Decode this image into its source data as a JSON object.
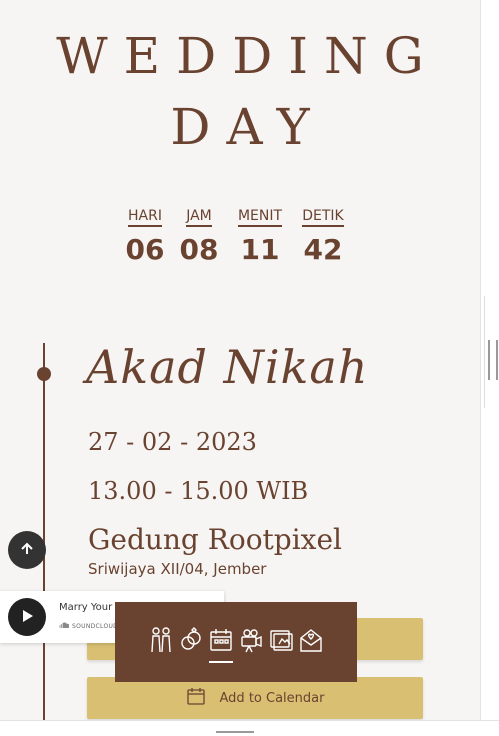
{
  "hero": {
    "title_line1": "WEDDING",
    "title_line2": "DAY"
  },
  "countdown": {
    "items": [
      {
        "label": "HARI",
        "value": "06"
      },
      {
        "label": "JAM",
        "value": "08"
      },
      {
        "label": "MENIT",
        "value": "11"
      },
      {
        "label": "DETIK",
        "value": "42"
      }
    ]
  },
  "event": {
    "title": "Akad Nikah",
    "date": "27 - 02 - 2023",
    "time": "13.00 - 15.00 WIB",
    "venue": "Gedung Rootpixel",
    "address": "Sriwijaya XII/04, Jember",
    "calendar_button_label": "Add to Calendar"
  },
  "music_player": {
    "song_title": "Marry Your D",
    "brand": "SOUNDCLOUD"
  },
  "bottom_nav": {
    "items": [
      {
        "icon": "couple-icon"
      },
      {
        "icon": "rings-icon"
      },
      {
        "icon": "calendar-icon",
        "active": true
      },
      {
        "icon": "camera-icon"
      },
      {
        "icon": "photo-gallery-icon"
      },
      {
        "icon": "envelope-icon"
      }
    ]
  },
  "colors": {
    "brown": "#6a4330",
    "gold": "#d8bf72",
    "background": "#f7f5f4"
  }
}
